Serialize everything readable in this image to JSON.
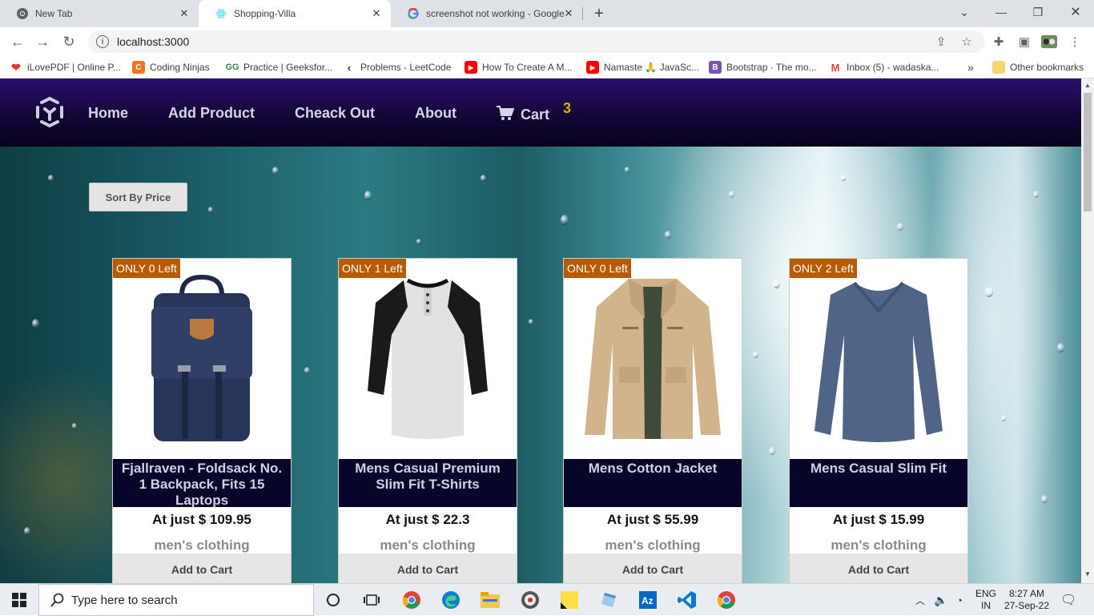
{
  "browser": {
    "tabs": [
      {
        "label": "New Tab",
        "icon": "chrome-icon",
        "active": false
      },
      {
        "label": "Shopping-Villa",
        "icon": "react-icon",
        "active": true
      },
      {
        "label": "screenshot not working - Google",
        "icon": "google-icon",
        "active": false
      }
    ],
    "url": "localhost:3000",
    "bookmarks": [
      {
        "label": "iLovePDF | Online P...",
        "color": "#e5322d"
      },
      {
        "label": "Coding Ninjas",
        "color": "#f47521"
      },
      {
        "label": "Practice | Geeksfor...",
        "color": "#2f8d46"
      },
      {
        "label": "Problems - LeetCode",
        "color": "#ffa116"
      },
      {
        "label": "How To Create A M...",
        "color": "#ff0000"
      },
      {
        "label": "Namaste 🙏 JavaSc...",
        "color": "#ff0000"
      },
      {
        "label": "Bootstrap · The mo...",
        "color": "#7952b3"
      },
      {
        "label": "Inbox (5) - wadaska...",
        "color": "#ea4335"
      }
    ],
    "overflow_label": "»",
    "other_bookmarks": "Other bookmarks"
  },
  "nav": {
    "links": [
      "Home",
      "Add Product",
      "Cheack Out",
      "About"
    ],
    "cart_label": "Cart",
    "cart_count": "3"
  },
  "sort_button": "Sort By Price",
  "products": [
    {
      "stock": "ONLY 0 Left",
      "title": "Fjallraven - Foldsack No. 1 Backpack, Fits 15 Laptops",
      "price": "At just $ 109.95",
      "category": "men's clothing",
      "add_label": "Add to Cart",
      "image": "backpack"
    },
    {
      "stock": "ONLY 1 Left",
      "title": "Mens Casual Premium Slim Fit T-Shirts",
      "price": "At just $ 22.3",
      "category": "men's clothing",
      "add_label": "Add to Cart",
      "image": "raglan-tshirt"
    },
    {
      "stock": "ONLY 0 Left",
      "title": "Mens Cotton Jacket",
      "price": "At just $ 55.99",
      "category": "men's clothing",
      "add_label": "Add to Cart",
      "image": "jacket"
    },
    {
      "stock": "ONLY 2 Left",
      "title": "Mens Casual Slim Fit",
      "price": "At just $ 15.99",
      "category": "men's clothing",
      "add_label": "Add to Cart",
      "image": "longsleeve"
    }
  ],
  "taskbar": {
    "search_placeholder": "Type here to search",
    "lang_top": "ENG",
    "lang_bottom": "IN",
    "time": "8:27 AM",
    "date": "27-Sep-22"
  }
}
